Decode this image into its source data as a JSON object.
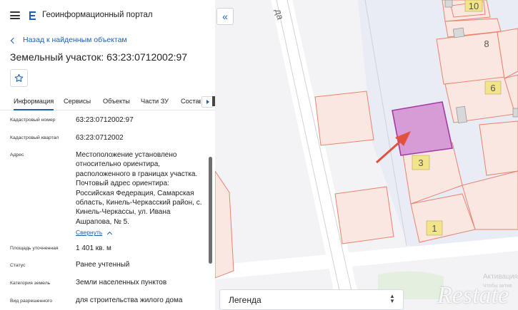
{
  "header": {
    "menu_icon": "hamburger-menu-icon",
    "logo_icon": "portal-logo-icon",
    "title": "Геоинформационный портал"
  },
  "nav": {
    "back_label": "Назад к найденным объектам"
  },
  "object": {
    "title": "Земельный участок: 63:23:0712002:97",
    "favorite_icon": "star-outline-icon"
  },
  "tabs": [
    {
      "label": "Информация",
      "active": true
    },
    {
      "label": "Сервисы",
      "active": false
    },
    {
      "label": "Объекты",
      "active": false
    },
    {
      "label": "Части ЗУ",
      "active": false
    },
    {
      "label": "Состав",
      "active": false
    }
  ],
  "details": {
    "cadastral_number": {
      "label": "Кадастровый номер",
      "value": "63:23:0712002:97"
    },
    "cadastral_quarter": {
      "label": "Кадастровый квартал",
      "value": "63:23:0712002"
    },
    "address": {
      "label": "Адрес",
      "value": "Местоположение установлено относительно ориентира, расположенного в границах участка. Почтовый адрес ориентира: Российская Федерация, Самарская область, Кинель-Черкасский район, с. Кинель-Черкассы, ул. Ивана Ашрапова, № 5.",
      "collapse_label": "Свернуть"
    },
    "area": {
      "label": "Площадь уточненная",
      "value": "1 401 кв. м"
    },
    "status": {
      "label": "Статус",
      "value": "Ранее учтенный"
    },
    "land_category": {
      "label": "Категория земель",
      "value": "Земли населенных пунктов"
    },
    "permitted_use": {
      "label": "Вид разрешенного",
      "value": "для строительства жилого дома"
    }
  },
  "map": {
    "collapse_label": "«",
    "street_fragment": "да",
    "house_numbers": [
      "10",
      "8",
      "6",
      "3",
      "1"
    ],
    "legend_label": "Легенда",
    "activation_text": "Активация",
    "activation_sub": "Чтобы актив",
    "watermark": "Restate",
    "colors": {
      "parcel_stroke": "#e8826e",
      "parcel_fill": "#fbe7e2",
      "selected_fill": "#d79bd6",
      "selected_stroke": "#a33aa6",
      "arrow": "#e2513b",
      "label_bg": "#f2e48a"
    }
  }
}
